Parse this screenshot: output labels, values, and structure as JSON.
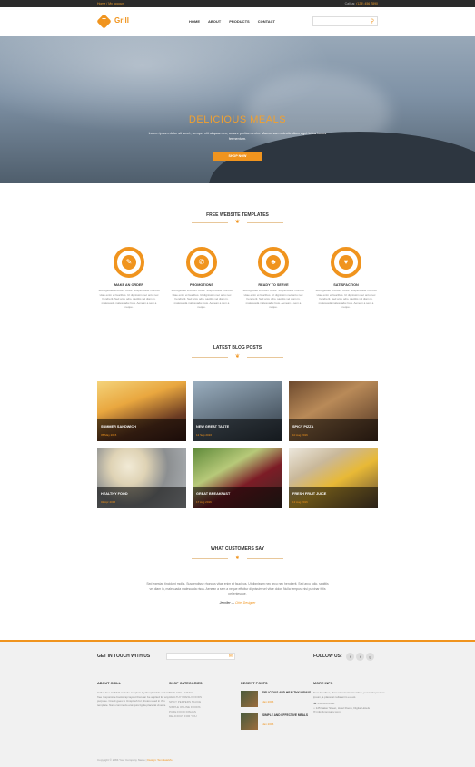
{
  "topbar": {
    "left": "Home / My account",
    "right_prefix": "Call us:",
    "right_phone": "(123) 456 7890"
  },
  "header": {
    "logo_letter": "T",
    "brand": "Grill",
    "nav": [
      "HOME",
      "ABOUT",
      "PRODUCTS",
      "CONTACT"
    ],
    "search_placeholder": ""
  },
  "hero": {
    "title": "DELICIOUS MEALS",
    "text": "Lorem ipsum dolor sit amet, semper elit aliquam eu, ornare pretium enim. Maecenas molestie diam eget tellus luctus fermentum.",
    "button": "SHOP NOW"
  },
  "features": {
    "title": "FREE WEBSITE TEMPLATES",
    "items": [
      {
        "icon": "pencil-icon",
        "glyph": "✎",
        "title": "MAKE AN ORDER",
        "text": "Sed egestas tincidunt mollis. Suspendisse rhoncus vitae enim et faucibus. Ut dignissim nec arcu nec hendrerit. Sed arcu odio, sagittis vel diam in, malesuada malesuada risus. Aenean a sem a neque."
      },
      {
        "icon": "megaphone-icon",
        "glyph": "✆",
        "title": "PROMOTIONS",
        "text": "Sed egestas tincidunt mollis. Suspendisse rhoncus vitae enim et faucibus. Ut dignissim nec arcu nec hendrerit. Sed arcu odio, sagittis vel diam in, malesuada malesuada risus. Aenean a sem a neque."
      },
      {
        "icon": "bell-icon",
        "glyph": "♣",
        "title": "READY TO SERVE",
        "text": "Sed egestas tincidunt mollis. Suspendisse rhoncus vitae enim et faucibus. Ut dignissim nec arcu nec hendrerit. Sed arcu odio, sagittis vel diam in, malesuada malesuada risus. Aenean a sem a neque."
      },
      {
        "icon": "heart-icon",
        "glyph": "♥",
        "title": "SATISFACTION",
        "text": "Sed egestas tincidunt mollis. Suspendisse rhoncus vitae enim et faucibus. Ut dignissim nec arcu nec hendrerit. Sed arcu odio, sagittis vel diam in, malesuada malesuada risus. Aenean a sem a neque."
      }
    ]
  },
  "blog": {
    "title": "LATEST BLOG POSTS",
    "posts": [
      {
        "title": "SUMMER SANDWICH",
        "date": "05 May 2015",
        "bg": "linear-gradient(160deg,#f4d37a 0%,#e9a73f 35%,#6a3b23 70%,#3c1c16 100%)"
      },
      {
        "title": "NEW GREAT TASTE",
        "date": "12 Sep 2016",
        "bg": "linear-gradient(160deg,#9aaebf 0%,#6a7a88 45%,#2f3943 100%)"
      },
      {
        "title": "SPICY PIZZA",
        "date": "10 Aug 2016",
        "bg": "linear-gradient(150deg,#6d4a2e 0%,#b98a58 40%,#4b3020 100%)"
      },
      {
        "title": "HEALTHY FOOD",
        "date": "02 Apr 2016",
        "bg": "radial-gradient(circle at 35% 30%,#f1ead6 0%,#dfd3b5 25%,#8c8f91 55%,#b0b4b8 100%)"
      },
      {
        "title": "GREAT BREAKFAST",
        "date": "17 Aug 2016",
        "bg": "linear-gradient(150deg,#5f8a3a 0%,#b7c979 35%,#7c1c26 60%,#3a2b24 100%)"
      },
      {
        "title": "FRESH FRUIT JUICE",
        "date": "13 Aug 2016",
        "bg": "linear-gradient(150deg,#ece7dc 0%,#c9b89a 30%,#e8b936 55%,#5e4a35 100%)"
      }
    ]
  },
  "testimonials": {
    "title": "WHAT CUSTOMERS SAY",
    "quote": "Sed egestas tincidunt mollis. Suspendisse rhoncus vitae enim et faucibus. Ut dignissim nec arcu nec hendrerit. Sed arcu odio, sagittis vel diam in, malesuada malesuada risus. Aenean a sem a neque efficitur dignissim vel vitae dolor. Nulla tempus, nisi pulvinar felis pellentesque.",
    "author": "Jennifer",
    "role": "Chief Designer"
  },
  "footer": {
    "get_in_touch": "GET IN TOUCH WITH US",
    "follow": "FOLLOW US:",
    "social": [
      "f",
      "t",
      "g"
    ],
    "about": {
      "title": "ABOUT GRILL",
      "text": "Grill is free HTML5 website template by TemplateMo and it is free responsive bootstrap layout that can be applied for any purpose. Credit goes to Unsplash for photos used in this template. Nam commodo erat quis ligula placerat viverra."
    },
    "categories": {
      "title": "SHOP CATEGORIES",
      "items": [
        "NEW GRILL MENU",
        "HEALTHY FRESH FOODS",
        "SPICY PEPPERS SAUCE",
        "SIMPLE ONLINE FOODS",
        "PURE FOOD DISHES",
        "DELICIOUS FOR YOU"
      ]
    },
    "recent": {
      "title": "RECENT POSTS",
      "items": [
        {
          "title": "DELICIOUS AND HEALTHY MENUS",
          "date": "Jan 2016"
        },
        {
          "title": "SIMPLE AND EFFECTIVE MEALS",
          "date": "Jan 2016"
        }
      ]
    },
    "more": {
      "title": "MORE INFO",
      "text": "Nam faucibus, diam id molestie faucibus, purus dui pretium ipsum, a placerat nulla enim eu est.",
      "phone": "010-020-0340",
      "address": "125 Baker Street, Hotel Room, Digital Hotels",
      "email": "info@company.com"
    },
    "copyright": "Copyright © 2084 Your Company Name",
    "credit": "Design: TemplateMo"
  }
}
